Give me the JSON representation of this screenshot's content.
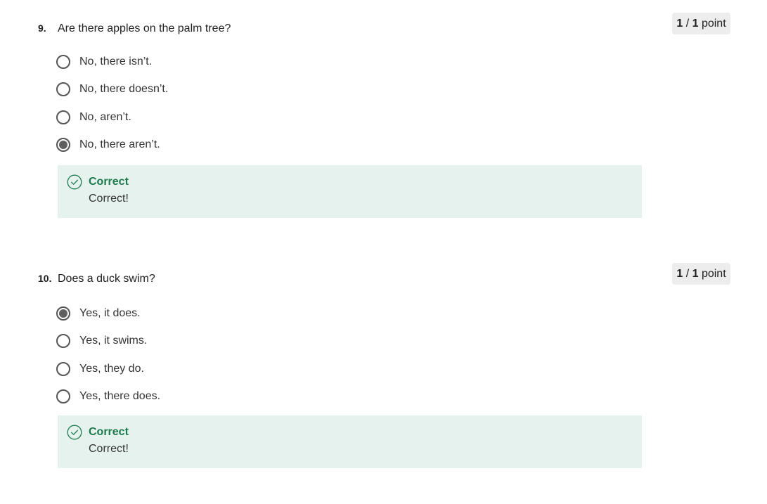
{
  "questions": [
    {
      "number": "9.",
      "text": "Are there apples on the palm tree?",
      "points": {
        "value": "1",
        "separator": " / ",
        "total": "1",
        "unit": " point"
      },
      "options": [
        {
          "label": "No, there isn’t.",
          "selected": false
        },
        {
          "label": "No, there doesn’t.",
          "selected": false
        },
        {
          "label": "No, aren’t.",
          "selected": false
        },
        {
          "label": "No, there aren’t.",
          "selected": true
        }
      ],
      "feedback": {
        "status": "Correct",
        "message": "Correct!",
        "icon": "check-circle-icon"
      }
    },
    {
      "number": "10.",
      "text": "Does a duck swim?",
      "points": {
        "value": "1",
        "separator": " / ",
        "total": "1",
        "unit": " point"
      },
      "options": [
        {
          "label": "Yes, it does.",
          "selected": true
        },
        {
          "label": "Yes, it swims.",
          "selected": false
        },
        {
          "label": "Yes, they do.",
          "selected": false
        },
        {
          "label": "Yes, there does.",
          "selected": false
        }
      ],
      "feedback": {
        "status": "Correct",
        "message": "Correct!",
        "icon": "check-circle-icon"
      }
    }
  ],
  "colors": {
    "correct_green": "#1d7a4e",
    "feedback_background": "#e6f2ee",
    "badge_background": "#ededed"
  }
}
